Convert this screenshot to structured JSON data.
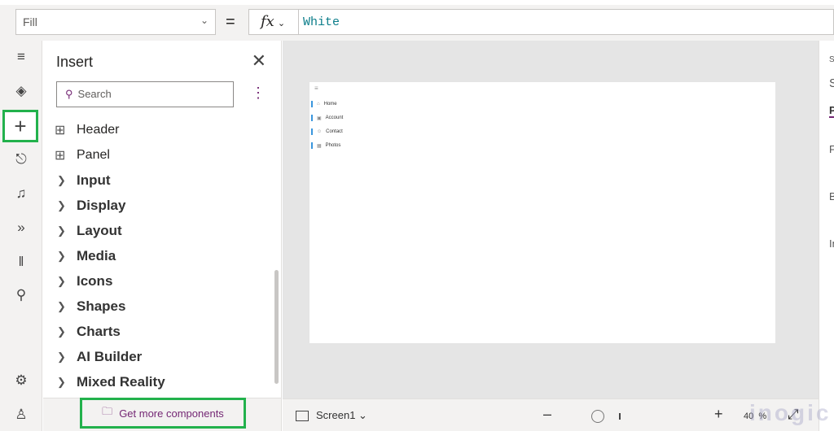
{
  "formula_bar": {
    "property": "Fill",
    "equals": "=",
    "fx": "fx",
    "value": "White"
  },
  "rail": {
    "items": [
      "menu",
      "tree-view",
      "insert",
      "data",
      "media",
      "power-automate",
      "advanced-tools",
      "search",
      "settings",
      "virtual-agent"
    ]
  },
  "insert_panel": {
    "title": "Insert",
    "search_placeholder": "Search",
    "items": [
      {
        "label": "Header",
        "type": "component"
      },
      {
        "label": "Panel",
        "type": "component"
      },
      {
        "label": "Input",
        "type": "category"
      },
      {
        "label": "Display",
        "type": "category"
      },
      {
        "label": "Layout",
        "type": "category"
      },
      {
        "label": "Media",
        "type": "category"
      },
      {
        "label": "Icons",
        "type": "category"
      },
      {
        "label": "Shapes",
        "type": "category"
      },
      {
        "label": "Charts",
        "type": "category"
      },
      {
        "label": "AI Builder",
        "type": "category"
      },
      {
        "label": "Mixed Reality",
        "type": "category"
      }
    ],
    "get_more": "Get more components"
  },
  "canvas": {
    "nav_items": [
      "Home",
      "Account",
      "Contact",
      "Photos"
    ]
  },
  "status": {
    "screen": "Screen1",
    "zoom": "40",
    "zoom_unit": "%"
  },
  "right_panel": {
    "l1": "S",
    "l2": "S",
    "tab": "P",
    "f": "F",
    "b": "B",
    "i": "In"
  },
  "watermark": "inogic",
  "colors": {
    "accent": "#742774",
    "highlight": "#22b14c",
    "formula": "#0b7d8a"
  }
}
